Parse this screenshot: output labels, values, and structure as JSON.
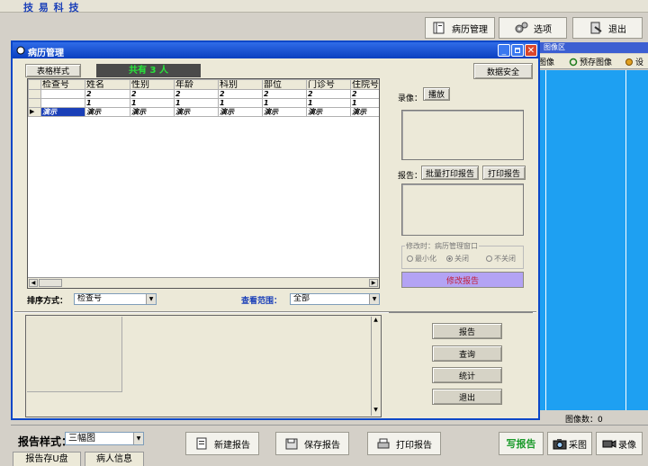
{
  "app": {
    "title": "技 易 科 技"
  },
  "top_toolbar": {
    "records_label": "病历管理",
    "options_label": "选项",
    "exit_label": "退出"
  },
  "window": {
    "title": "病历管理"
  },
  "table_panel": {
    "style_button": "表格样式",
    "total_label": "共有 3 人",
    "data_safety_button": "数据安全",
    "columns": [
      "检查号",
      "姓名",
      "性别",
      "年龄",
      "科别",
      "部位",
      "门诊号",
      "住院号"
    ],
    "rows": [
      [
        "",
        "2",
        "2",
        "2",
        "2",
        "2",
        "2",
        "2"
      ],
      [
        "",
        "1",
        "1",
        "1",
        "1",
        "1",
        "1",
        "1"
      ],
      [
        "演示",
        "演示",
        "演示",
        "演示",
        "演示",
        "演示",
        "演示",
        "演示"
      ]
    ]
  },
  "sort": {
    "label": "排序方式：",
    "value": "检查号"
  },
  "view_range": {
    "label": "查看范围：",
    "value": "全部"
  },
  "right_panel": {
    "record_label": "录像：",
    "play_button": "播放",
    "report_label": "报告：",
    "batch_print_button": "批量打印报告",
    "print_report_button": "打印报告",
    "modify_group_title": "修改时：病历管理窗口",
    "radio_minimize": "最小化",
    "radio_close": "关闭",
    "radio_no_close": "不关闭",
    "modify_report_button": "修改报告"
  },
  "action_buttons": {
    "report": "报告",
    "query": "查询",
    "stats": "统计",
    "exit": "退出"
  },
  "image_area": {
    "header": "图像区",
    "btn_save": "图像",
    "btn_preview": "预存图像",
    "btn_more": "设",
    "count_label": "图像数：0"
  },
  "bottom": {
    "report_style_label": "报告样式：",
    "report_style_value": "三幅图",
    "new_report": "新建报告",
    "save_report": "保存报告",
    "print_report": "打印报告",
    "write_report": "写报告",
    "capture": "采图",
    "record": "录像",
    "tab_usb": "报告存U盘",
    "tab_patient": "病人信息"
  },
  "colors": {
    "title_blue": "#1a3fb8",
    "screen_cyan": "#1ea0f2",
    "total_green": "#27e83a",
    "modify_purple": "#b3a3f4"
  }
}
